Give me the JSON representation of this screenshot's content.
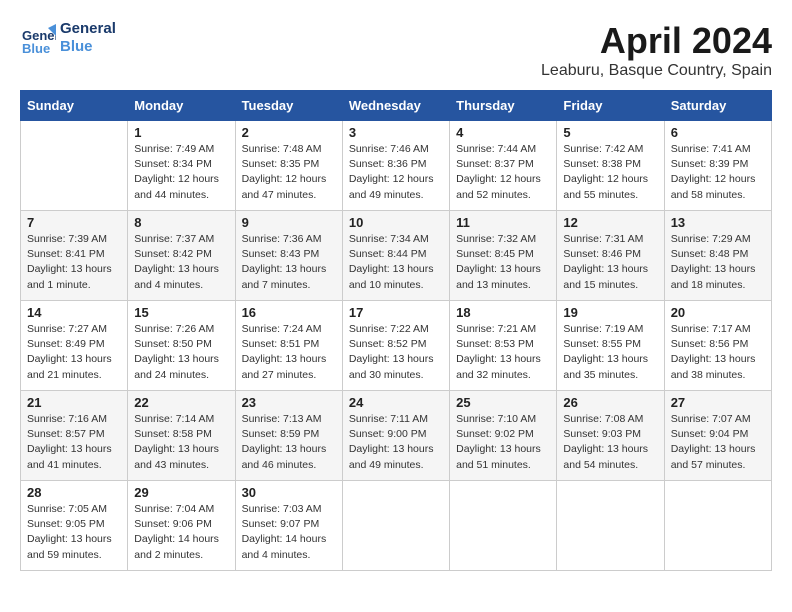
{
  "header": {
    "logo_line1": "General",
    "logo_line2": "Blue",
    "month": "April 2024",
    "location": "Leaburu, Basque Country, Spain"
  },
  "days_of_week": [
    "Sunday",
    "Monday",
    "Tuesday",
    "Wednesday",
    "Thursday",
    "Friday",
    "Saturday"
  ],
  "weeks": [
    [
      {
        "day": "",
        "sunrise": "",
        "sunset": "",
        "daylight": ""
      },
      {
        "day": "1",
        "sunrise": "Sunrise: 7:49 AM",
        "sunset": "Sunset: 8:34 PM",
        "daylight": "Daylight: 12 hours and 44 minutes."
      },
      {
        "day": "2",
        "sunrise": "Sunrise: 7:48 AM",
        "sunset": "Sunset: 8:35 PM",
        "daylight": "Daylight: 12 hours and 47 minutes."
      },
      {
        "day": "3",
        "sunrise": "Sunrise: 7:46 AM",
        "sunset": "Sunset: 8:36 PM",
        "daylight": "Daylight: 12 hours and 49 minutes."
      },
      {
        "day": "4",
        "sunrise": "Sunrise: 7:44 AM",
        "sunset": "Sunset: 8:37 PM",
        "daylight": "Daylight: 12 hours and 52 minutes."
      },
      {
        "day": "5",
        "sunrise": "Sunrise: 7:42 AM",
        "sunset": "Sunset: 8:38 PM",
        "daylight": "Daylight: 12 hours and 55 minutes."
      },
      {
        "day": "6",
        "sunrise": "Sunrise: 7:41 AM",
        "sunset": "Sunset: 8:39 PM",
        "daylight": "Daylight: 12 hours and 58 minutes."
      }
    ],
    [
      {
        "day": "7",
        "sunrise": "Sunrise: 7:39 AM",
        "sunset": "Sunset: 8:41 PM",
        "daylight": "Daylight: 13 hours and 1 minute."
      },
      {
        "day": "8",
        "sunrise": "Sunrise: 7:37 AM",
        "sunset": "Sunset: 8:42 PM",
        "daylight": "Daylight: 13 hours and 4 minutes."
      },
      {
        "day": "9",
        "sunrise": "Sunrise: 7:36 AM",
        "sunset": "Sunset: 8:43 PM",
        "daylight": "Daylight: 13 hours and 7 minutes."
      },
      {
        "day": "10",
        "sunrise": "Sunrise: 7:34 AM",
        "sunset": "Sunset: 8:44 PM",
        "daylight": "Daylight: 13 hours and 10 minutes."
      },
      {
        "day": "11",
        "sunrise": "Sunrise: 7:32 AM",
        "sunset": "Sunset: 8:45 PM",
        "daylight": "Daylight: 13 hours and 13 minutes."
      },
      {
        "day": "12",
        "sunrise": "Sunrise: 7:31 AM",
        "sunset": "Sunset: 8:46 PM",
        "daylight": "Daylight: 13 hours and 15 minutes."
      },
      {
        "day": "13",
        "sunrise": "Sunrise: 7:29 AM",
        "sunset": "Sunset: 8:48 PM",
        "daylight": "Daylight: 13 hours and 18 minutes."
      }
    ],
    [
      {
        "day": "14",
        "sunrise": "Sunrise: 7:27 AM",
        "sunset": "Sunset: 8:49 PM",
        "daylight": "Daylight: 13 hours and 21 minutes."
      },
      {
        "day": "15",
        "sunrise": "Sunrise: 7:26 AM",
        "sunset": "Sunset: 8:50 PM",
        "daylight": "Daylight: 13 hours and 24 minutes."
      },
      {
        "day": "16",
        "sunrise": "Sunrise: 7:24 AM",
        "sunset": "Sunset: 8:51 PM",
        "daylight": "Daylight: 13 hours and 27 minutes."
      },
      {
        "day": "17",
        "sunrise": "Sunrise: 7:22 AM",
        "sunset": "Sunset: 8:52 PM",
        "daylight": "Daylight: 13 hours and 30 minutes."
      },
      {
        "day": "18",
        "sunrise": "Sunrise: 7:21 AM",
        "sunset": "Sunset: 8:53 PM",
        "daylight": "Daylight: 13 hours and 32 minutes."
      },
      {
        "day": "19",
        "sunrise": "Sunrise: 7:19 AM",
        "sunset": "Sunset: 8:55 PM",
        "daylight": "Daylight: 13 hours and 35 minutes."
      },
      {
        "day": "20",
        "sunrise": "Sunrise: 7:17 AM",
        "sunset": "Sunset: 8:56 PM",
        "daylight": "Daylight: 13 hours and 38 minutes."
      }
    ],
    [
      {
        "day": "21",
        "sunrise": "Sunrise: 7:16 AM",
        "sunset": "Sunset: 8:57 PM",
        "daylight": "Daylight: 13 hours and 41 minutes."
      },
      {
        "day": "22",
        "sunrise": "Sunrise: 7:14 AM",
        "sunset": "Sunset: 8:58 PM",
        "daylight": "Daylight: 13 hours and 43 minutes."
      },
      {
        "day": "23",
        "sunrise": "Sunrise: 7:13 AM",
        "sunset": "Sunset: 8:59 PM",
        "daylight": "Daylight: 13 hours and 46 minutes."
      },
      {
        "day": "24",
        "sunrise": "Sunrise: 7:11 AM",
        "sunset": "Sunset: 9:00 PM",
        "daylight": "Daylight: 13 hours and 49 minutes."
      },
      {
        "day": "25",
        "sunrise": "Sunrise: 7:10 AM",
        "sunset": "Sunset: 9:02 PM",
        "daylight": "Daylight: 13 hours and 51 minutes."
      },
      {
        "day": "26",
        "sunrise": "Sunrise: 7:08 AM",
        "sunset": "Sunset: 9:03 PM",
        "daylight": "Daylight: 13 hours and 54 minutes."
      },
      {
        "day": "27",
        "sunrise": "Sunrise: 7:07 AM",
        "sunset": "Sunset: 9:04 PM",
        "daylight": "Daylight: 13 hours and 57 minutes."
      }
    ],
    [
      {
        "day": "28",
        "sunrise": "Sunrise: 7:05 AM",
        "sunset": "Sunset: 9:05 PM",
        "daylight": "Daylight: 13 hours and 59 minutes."
      },
      {
        "day": "29",
        "sunrise": "Sunrise: 7:04 AM",
        "sunset": "Sunset: 9:06 PM",
        "daylight": "Daylight: 14 hours and 2 minutes."
      },
      {
        "day": "30",
        "sunrise": "Sunrise: 7:03 AM",
        "sunset": "Sunset: 9:07 PM",
        "daylight": "Daylight: 14 hours and 4 minutes."
      },
      {
        "day": "",
        "sunrise": "",
        "sunset": "",
        "daylight": ""
      },
      {
        "day": "",
        "sunrise": "",
        "sunset": "",
        "daylight": ""
      },
      {
        "day": "",
        "sunrise": "",
        "sunset": "",
        "daylight": ""
      },
      {
        "day": "",
        "sunrise": "",
        "sunset": "",
        "daylight": ""
      }
    ]
  ]
}
